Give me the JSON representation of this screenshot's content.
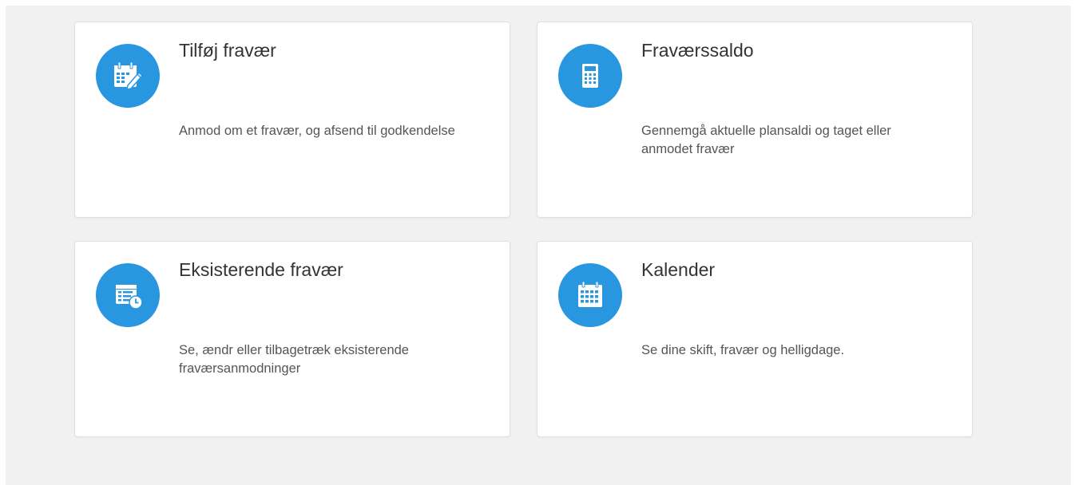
{
  "theme": {
    "accent": "#2996e0",
    "background": "#f1f1f2",
    "card_background": "#ffffff"
  },
  "cards": [
    {
      "title": "Tilføj fravær",
      "description": "Anmod om et fravær, og afsend til godkendelse",
      "icon": "calendar-edit-icon"
    },
    {
      "title": "Fraværssaldo",
      "description": "Gennemgå aktuelle plansaldi og taget eller anmodet fravær",
      "icon": "calculator-icon"
    },
    {
      "title": "Eksisterende fravær",
      "description": "Se, ændr eller tilbagetræk eksisterende fraværsanmodninger",
      "icon": "list-clock-icon"
    },
    {
      "title": "Kalender",
      "description": "Se dine skift, fravær og helligdage.",
      "icon": "calendar-icon"
    }
  ]
}
